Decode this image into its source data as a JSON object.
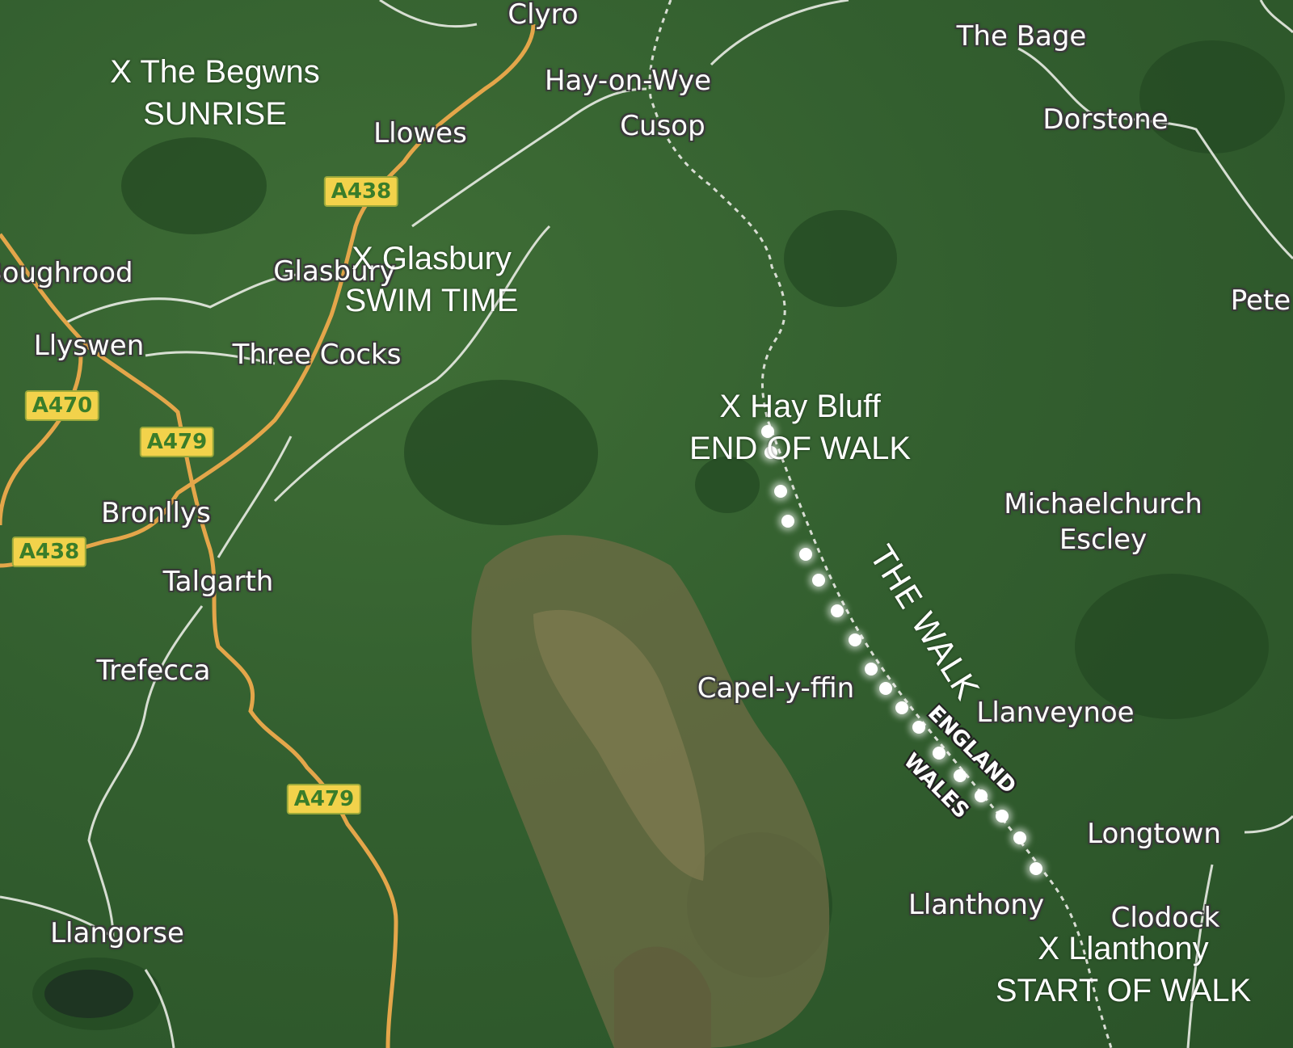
{
  "map": {
    "colors": {
      "terrain": "#2f5a2c",
      "upland": "#6b6a44",
      "road_a": "#e4a64a",
      "minor_road": "#e9ece4",
      "route_dot": "#ffffff"
    },
    "place_labels": [
      {
        "id": "clyro",
        "text": "Clyro"
      },
      {
        "id": "the-bage",
        "text": "The Bage"
      },
      {
        "id": "hay-on-wye",
        "text": "Hay-on-Wye"
      },
      {
        "id": "cusop",
        "text": "Cusop"
      },
      {
        "id": "dorstone",
        "text": "Dorstone"
      },
      {
        "id": "llowes",
        "text": "Llowes"
      },
      {
        "id": "boughrood",
        "text": "Boughrood"
      },
      {
        "id": "glasbury",
        "text": "Glasbury"
      },
      {
        "id": "peterchurch",
        "text": "Pete"
      },
      {
        "id": "llyswen",
        "text": "Llyswen"
      },
      {
        "id": "three-cocks",
        "text": "Three Cocks"
      },
      {
        "id": "bronllys",
        "text": "Bronllys"
      },
      {
        "id": "talgarth",
        "text": "Talgarth"
      },
      {
        "id": "trefecca",
        "text": "Trefecca"
      },
      {
        "id": "capel-y-ffin",
        "text": "Capel-y-ffin"
      },
      {
        "id": "llanveynoe",
        "text": "Llanveynoe"
      },
      {
        "id": "longtown",
        "text": "Longtown"
      },
      {
        "id": "llanthony",
        "text": "Llanthony"
      },
      {
        "id": "clodock",
        "text": "Clodock"
      },
      {
        "id": "llangorse",
        "text": "Llangorse"
      },
      {
        "id": "michaelchurch",
        "line1": "Michaelchurch",
        "line2": "Escley"
      }
    ],
    "road_shields": [
      {
        "id": "a438-north",
        "text": "A438"
      },
      {
        "id": "a470",
        "text": "A470"
      },
      {
        "id": "a479-north",
        "text": "A479"
      },
      {
        "id": "a438-west",
        "text": "A438"
      },
      {
        "id": "a479-south",
        "text": "A479"
      }
    ],
    "annotations": [
      {
        "id": "begwns",
        "line1": "X The Begwns",
        "line2": "SUNRISE"
      },
      {
        "id": "glasbury-swim",
        "line1": "X Glasbury",
        "line2": "SWIM TIME"
      },
      {
        "id": "hay-bluff",
        "line1": "X Hay Bluff",
        "line2": "END OF WALK"
      },
      {
        "id": "llanthony-start",
        "line1": "X Llanthony",
        "line2": "START OF WALK"
      }
    ],
    "walk_label": "THE WALK",
    "border_labels": {
      "england": "ENGLAND",
      "wales": "WALES"
    }
  }
}
